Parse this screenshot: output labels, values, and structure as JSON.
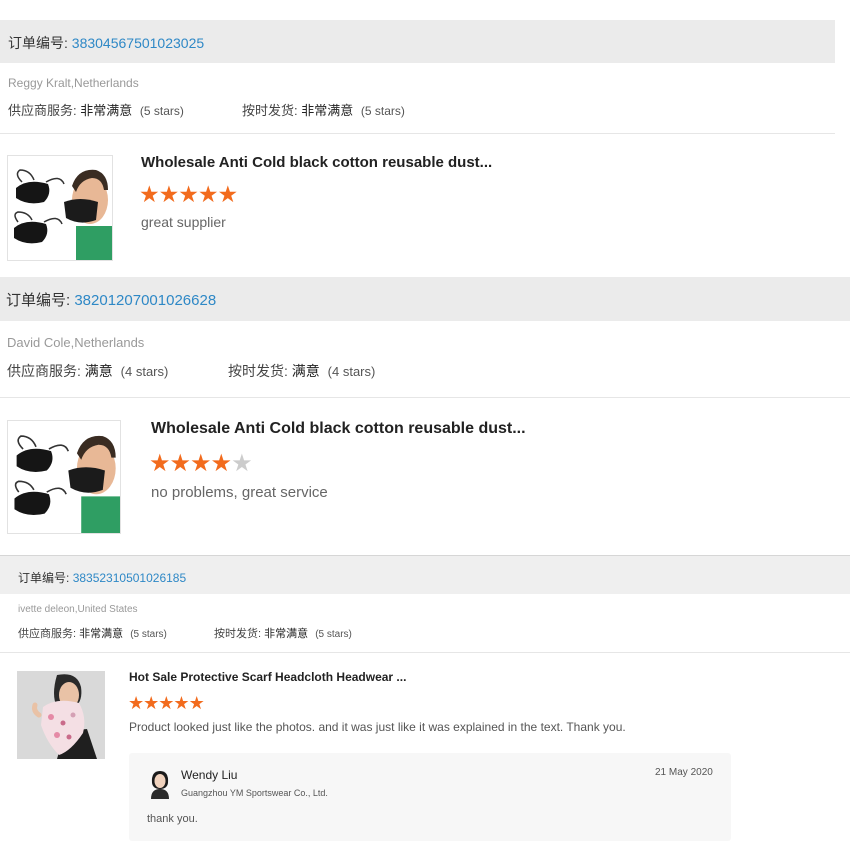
{
  "reviews": [
    {
      "order_label": "订单编号:",
      "order_number": "38304567501023025",
      "buyer": "Reggy Kralt,Netherlands",
      "service_label": "供应商服务:",
      "service_rating": "非常满意",
      "service_stars": "(5 stars)",
      "shipping_label": "按时发货:",
      "shipping_rating": "非常满意",
      "shipping_stars": "(5 stars)",
      "product_title": "Wholesale Anti Cold black cotton reusable dust...",
      "rating": 5,
      "comment": "great supplier"
    },
    {
      "order_label": "订单编号:",
      "order_number": "38201207001026628",
      "buyer": "David Cole,Netherlands",
      "service_label": "供应商服务:",
      "service_rating": "满意",
      "service_stars": "(4 stars)",
      "shipping_label": "按时发货:",
      "shipping_rating": "满意",
      "shipping_stars": "(4 stars)",
      "product_title": "Wholesale Anti Cold black cotton reusable dust...",
      "rating": 4,
      "comment": "no problems, great service"
    },
    {
      "order_label": "订单编号:",
      "order_number": "38352310501026185",
      "buyer": "ivette deleon,United States",
      "service_label": "供应商服务:",
      "service_rating": "非常满意",
      "service_stars": "(5 stars)",
      "shipping_label": "按时发货:",
      "shipping_rating": "非常满意",
      "shipping_stars": "(5 stars)",
      "product_title": "Hot Sale Protective Scarf Headcloth Headwear ...",
      "rating": 5,
      "comment": "Product looked just like the photos. and it was just like it was explained in the text. Thank you.",
      "reply": {
        "name": "Wendy Liu",
        "company": "Guangzhou YM Sportswear Co., Ltd.",
        "date": "21 May 2020",
        "text": "thank you."
      }
    }
  ],
  "colors": {
    "link": "#2e88c6",
    "star_on": "#f26b1d",
    "star_off": "#cccccc",
    "order_bar": "#ebebeb"
  },
  "icons": {
    "star": "star-icon",
    "avatar": "avatar-icon",
    "mask_product": "mask-product-image",
    "scarf_product": "scarf-product-image"
  }
}
